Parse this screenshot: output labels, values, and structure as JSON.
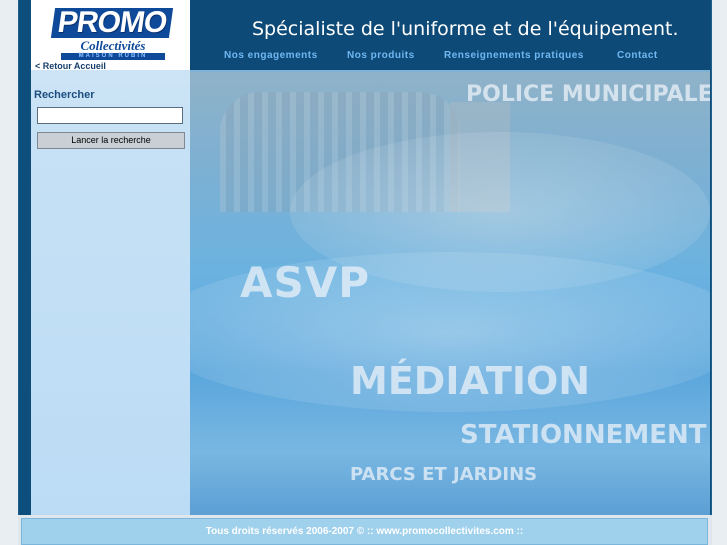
{
  "logo": {
    "brand": "PROMO",
    "subtitle": "Collectivités",
    "tagline": "MAISON RUBIN"
  },
  "back_link": "< Retour Accueil",
  "header": {
    "tagline": "Spécialiste de l'uniforme et de l'équipement."
  },
  "nav": [
    {
      "label": "Nos engagements"
    },
    {
      "label": "Nos produits"
    },
    {
      "label": "Renseignements pratiques"
    },
    {
      "label": "Contact"
    }
  ],
  "search": {
    "title": "Rechercher",
    "value": "",
    "button": "Lancer la recherche"
  },
  "hero": {
    "words": [
      "POLICE MUNICIPALE",
      "ASVP",
      "MÉDIATION",
      "STATIONNEMENT",
      "PARCS ET JARDINS"
    ]
  },
  "footer": {
    "text": "Tous droits réservés 2006-2007 © :: www.promocollectivites.com ::"
  },
  "colors": {
    "header_bg": "#0e4a78",
    "nav_link": "#6fb8f2",
    "sidebar_bg": "#c6e1f5",
    "footer_bg": "#9fd0ec"
  }
}
